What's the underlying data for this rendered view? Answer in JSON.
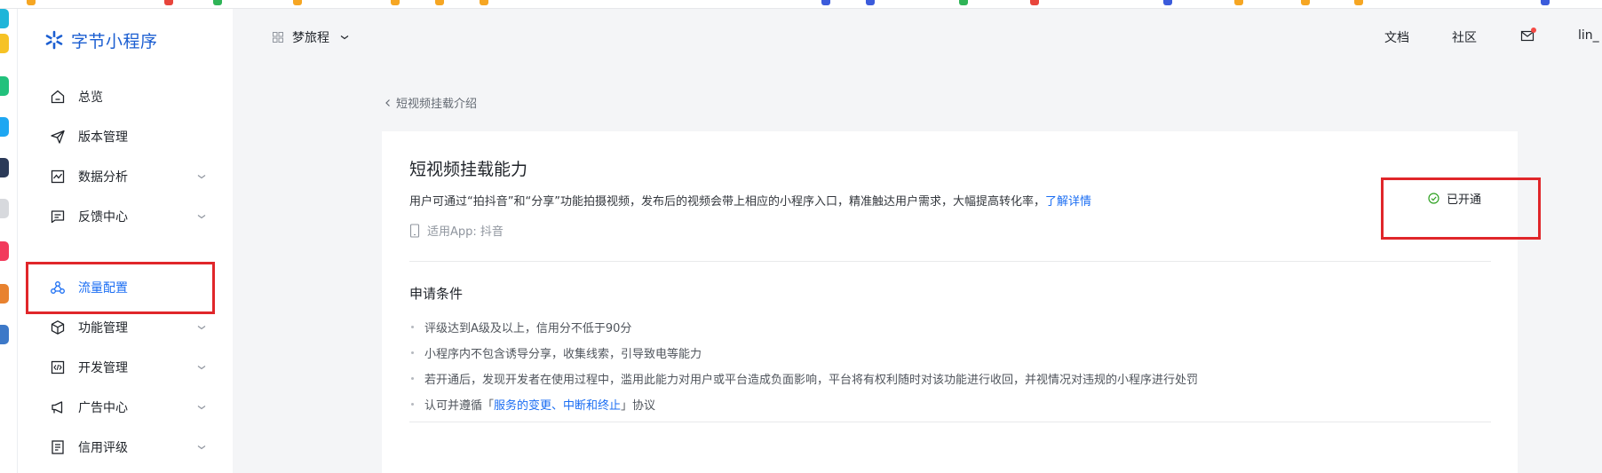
{
  "brand": {
    "name": "字节小程序"
  },
  "header": {
    "app_name": "梦旅程",
    "links": {
      "docs": "文档",
      "community": "社区"
    },
    "user": "lin_"
  },
  "sidebar": {
    "items": [
      {
        "label": "总览",
        "icon": "home-icon"
      },
      {
        "label": "版本管理",
        "icon": "send-icon"
      },
      {
        "label": "数据分析",
        "icon": "chart-icon"
      },
      {
        "label": "反馈中心",
        "icon": "feedback-icon"
      },
      {
        "label": "流量配置",
        "icon": "traffic-icon"
      },
      {
        "label": "功能管理",
        "icon": "cube-icon"
      },
      {
        "label": "开发管理",
        "icon": "code-icon"
      },
      {
        "label": "广告中心",
        "icon": "megaphone-icon"
      },
      {
        "label": "信用评级",
        "icon": "document-icon"
      }
    ]
  },
  "breadcrumb": {
    "back_label": "短视频挂载介绍"
  },
  "card": {
    "title": "短视频挂载能力",
    "description": "用户可通过“拍抖音”和“分享”功能拍摄视频，发布后的视频会带上相应的小程序入口，精准触达用户需求，大幅提高转化率，",
    "learn_more": "了解详情",
    "applies_to": "适用App: 抖音",
    "status": "已开通",
    "status_color": "#2ea121"
  },
  "conditions": {
    "title": "申请条件",
    "items": [
      "评级达到A级及以上，信用分不低于90分",
      "小程序内不包含诱导分享，收集线索，引导致电等能力",
      "若开通后，发现开发者在使用过程中，滥用此能力对用户或平台造成负面影响，平台将有权利随时对该功能进行收回，并视情况对违规的小程序进行处罚"
    ],
    "agreement_prefix": "认可并遵循「",
    "agreement_link": "服务的变更、中断和终止",
    "agreement_suffix": "」协议"
  },
  "colors": {
    "accent": "#1b6ef3",
    "highlight": "#e0262a"
  }
}
